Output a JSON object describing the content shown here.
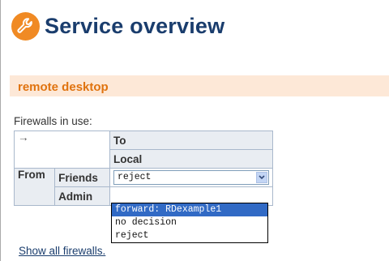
{
  "header": {
    "title": "Service overview",
    "logo_icon": "wrench-icon"
  },
  "colors": {
    "accent": "#f08a24",
    "title": "#1a3d6d",
    "section_text": "#e0730f",
    "section_band": "#fde8d7",
    "selected": "#316ac5"
  },
  "section": {
    "title": "remote desktop"
  },
  "firewalls": {
    "label": "Firewalls in use:",
    "arrow": "→",
    "to_label": "To",
    "to_zone": "Local",
    "from_label": "From",
    "rows": [
      {
        "zone": "Friends",
        "selected": "reject"
      },
      {
        "zone": "Admin"
      }
    ]
  },
  "dropdown": {
    "options": [
      "forward: RDexample1",
      "no decision",
      "reject"
    ],
    "highlighted_index": 0
  },
  "link": {
    "show_all": "Show all firewalls."
  }
}
